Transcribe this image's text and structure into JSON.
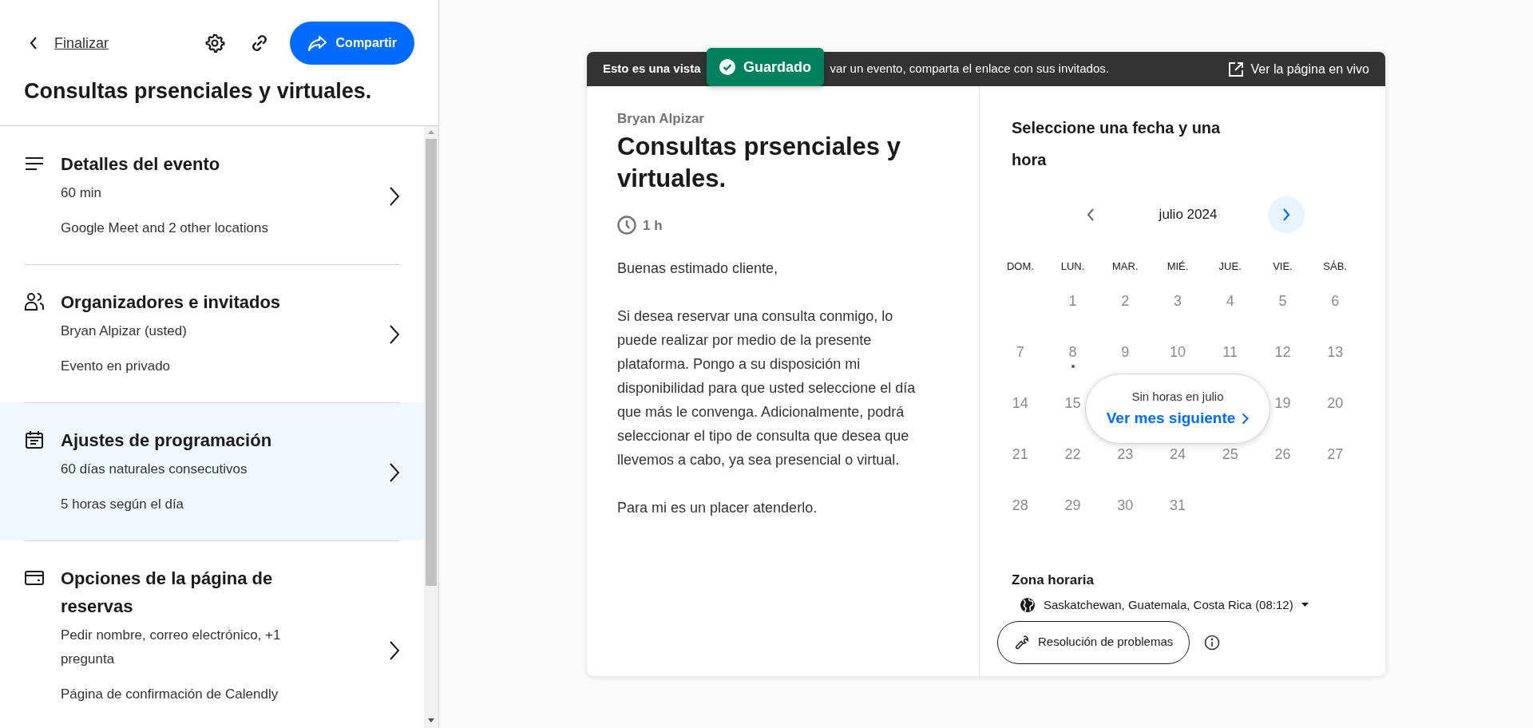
{
  "header": {
    "back_label": "Finalizar",
    "share_label": "Compartir",
    "title": "Consultas prsenciales y virtuales."
  },
  "sections": [
    {
      "kind": "details",
      "title": "Detalles del evento",
      "lines": [
        "60 min",
        "Google Meet and 2 other locations"
      ],
      "selected": false
    },
    {
      "kind": "people",
      "title": "Organizadores e invitados",
      "lines": [
        "Bryan Alpizar (usted)",
        "Evento en privado"
      ],
      "selected": false
    },
    {
      "kind": "calendar",
      "title": "Ajustes de programación",
      "lines": [
        "60 días naturales consecutivos",
        "5 horas según el día"
      ],
      "selected": true
    },
    {
      "kind": "card",
      "title": "Opciones de la página de reservas",
      "lines": [
        "Pedir nombre, correo electrónico, +1 pregunta",
        "Página de confirmación de Calendly"
      ],
      "selected": false
    }
  ],
  "preview": {
    "banner_start": "Esto es una vista",
    "banner_rest": "var un evento, comparta el enlace con sus invitados.",
    "live_link": "Ver la página en vivo",
    "toast": "Guardado",
    "host": "Bryan Alpizar",
    "event_title": "Consultas prsenciales y virtuales.",
    "duration": "1 h",
    "description": [
      "Buenas estimado cliente,",
      "Si desea reservar una consulta conmigo, lo puede realizar por medio de la presente plataforma. Pongo a su disposición mi disponibilidad para que usted seleccione el día que más le convenga. Adicionalmente, podrá seleccionar el tipo de consulta que desea que llevemos a cabo, ya sea presencial o virtual.",
      "Para mi es un placer atenderlo."
    ],
    "calendar": {
      "heading": "Seleccione una fecha y una hora",
      "month": "julio 2024",
      "weekdays": [
        "DOM.",
        "LUN.",
        "MAR.",
        "MIÉ.",
        "JUE.",
        "VIE.",
        "SÁB."
      ],
      "weeks": [
        [
          {
            "kind": "blank"
          },
          {
            "kind": "day",
            "day": "1",
            "today": false
          },
          {
            "kind": "day",
            "day": "2",
            "today": false
          },
          {
            "kind": "day",
            "day": "3",
            "today": false
          },
          {
            "kind": "day",
            "day": "4",
            "today": false
          },
          {
            "kind": "day",
            "day": "5",
            "today": false
          },
          {
            "kind": "day",
            "day": "6",
            "today": false
          }
        ],
        [
          {
            "kind": "day",
            "day": "7",
            "today": false
          },
          {
            "kind": "day",
            "day": "8",
            "today": true
          },
          {
            "kind": "day",
            "day": "9",
            "today": false
          },
          {
            "kind": "day",
            "day": "10",
            "today": false
          },
          {
            "kind": "day",
            "day": "11",
            "today": false
          },
          {
            "kind": "day",
            "day": "12",
            "today": false
          },
          {
            "kind": "day",
            "day": "13",
            "today": false
          }
        ],
        [
          {
            "kind": "day",
            "day": "14",
            "today": false
          },
          {
            "kind": "day",
            "day": "15",
            "today": false
          },
          {
            "kind": "covered"
          },
          {
            "kind": "covered"
          },
          {
            "kind": "covered"
          },
          {
            "kind": "day",
            "day": "19",
            "today": false
          },
          {
            "kind": "day",
            "day": "20",
            "today": false
          }
        ],
        [
          {
            "kind": "day",
            "day": "21",
            "today": false
          },
          {
            "kind": "day",
            "day": "22",
            "today": false
          },
          {
            "kind": "day",
            "day": "23",
            "today": false
          },
          {
            "kind": "day",
            "day": "24",
            "today": false
          },
          {
            "kind": "day",
            "day": "25",
            "today": false
          },
          {
            "kind": "day",
            "day": "26",
            "today": false
          },
          {
            "kind": "day",
            "day": "27",
            "today": false
          }
        ],
        [
          {
            "kind": "day",
            "day": "28",
            "today": false
          },
          {
            "kind": "day",
            "day": "29",
            "today": false
          },
          {
            "kind": "day",
            "day": "30",
            "today": false
          },
          {
            "kind": "day",
            "day": "31",
            "today": false
          },
          {
            "kind": "blank"
          },
          {
            "kind": "blank"
          },
          {
            "kind": "blank"
          }
        ]
      ],
      "popup_note": "Sin horas en julio",
      "popup_link": "Ver mes siguiente"
    },
    "timezone_label": "Zona horaria",
    "timezone": "Saskatchewan, Guatemala, Costa Rica (08:12)",
    "troubleshoot": "Resolución de problemas"
  }
}
